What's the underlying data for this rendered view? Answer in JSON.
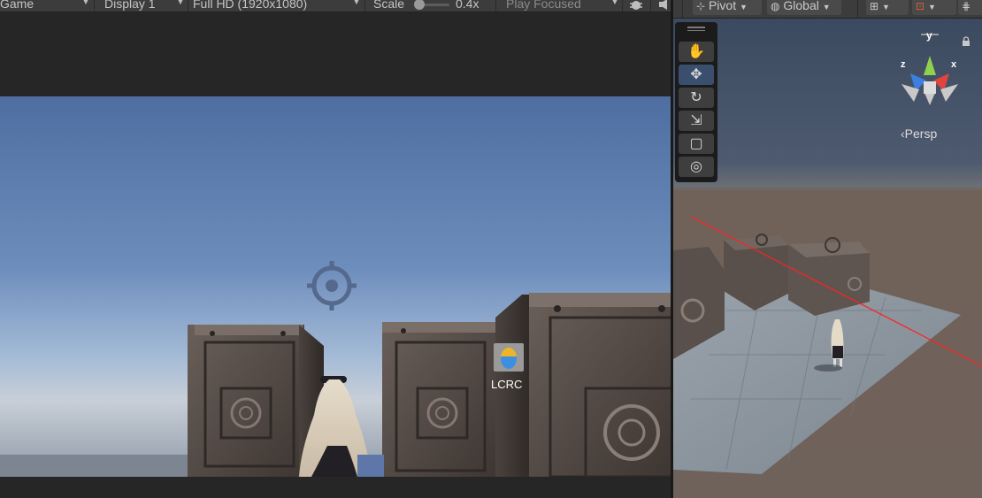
{
  "game_toolbar": {
    "view_label": "Game",
    "display": "Display 1",
    "resolution": "Full HD (1920x1080)",
    "scale_label": "Scale",
    "scale_value": "0.4x",
    "play_mode": "Play Focused"
  },
  "game_view": {
    "overlay_label": "LCRC"
  },
  "scene_toolbar": {
    "pivot": "Pivot",
    "global": "Global"
  },
  "scene_view": {
    "gizmo_axis_x": "x",
    "gizmo_axis_y": "y",
    "gizmo_axis_z": "z",
    "projection_label": "‹Persp"
  },
  "tools": [
    {
      "name": "hand-tool",
      "glyph": "✋"
    },
    {
      "name": "move-tool",
      "glyph": "✥"
    },
    {
      "name": "rotate-tool",
      "glyph": "↻"
    },
    {
      "name": "scale-tool",
      "glyph": "⇲"
    },
    {
      "name": "rect-tool",
      "glyph": "▢"
    },
    {
      "name": "transform-tool",
      "glyph": "◎"
    }
  ],
  "colors": {
    "sky_top": "#4e6ea1",
    "active_tool": "#3a4f6e",
    "gizmo_x": "#e0443e",
    "gizmo_y": "#8fd14f",
    "gizmo_z": "#3d7fe0"
  }
}
